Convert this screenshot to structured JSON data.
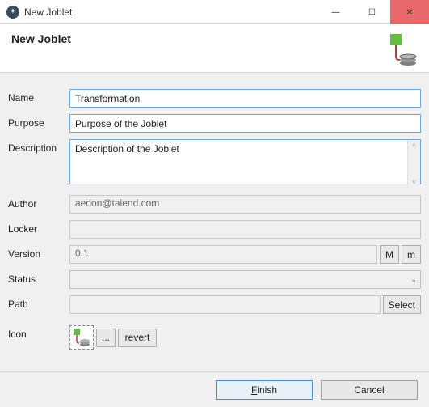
{
  "window": {
    "title": "New Joblet",
    "min_glyph": "—",
    "max_glyph": "☐",
    "close_glyph": "✕"
  },
  "header": {
    "title": "New Joblet"
  },
  "form": {
    "name": {
      "label": "Name",
      "value": "Transformation"
    },
    "purpose": {
      "label": "Purpose",
      "value": "Purpose of the Joblet"
    },
    "description": {
      "label": "Description",
      "value": "Description of the Joblet"
    },
    "author": {
      "label": "Author",
      "value": "aedon@talend.com"
    },
    "locker": {
      "label": "Locker",
      "value": ""
    },
    "version": {
      "label": "Version",
      "value": "0.1",
      "btn_major": "M",
      "btn_minor": "m"
    },
    "status": {
      "label": "Status",
      "value": ""
    },
    "path": {
      "label": "Path",
      "value": "",
      "btn_select": "Select"
    },
    "icon": {
      "label": "Icon",
      "btn_browse": "...",
      "btn_revert": "revert"
    }
  },
  "footer": {
    "finish_pre": "",
    "finish_u": "F",
    "finish_post": "inish",
    "cancel": "Cancel"
  },
  "colors": {
    "accent": "#6aa9d8",
    "close_btn": "#e9696b",
    "joblet_green": "#66bb44",
    "joblet_gray": "#7f7f7f"
  }
}
